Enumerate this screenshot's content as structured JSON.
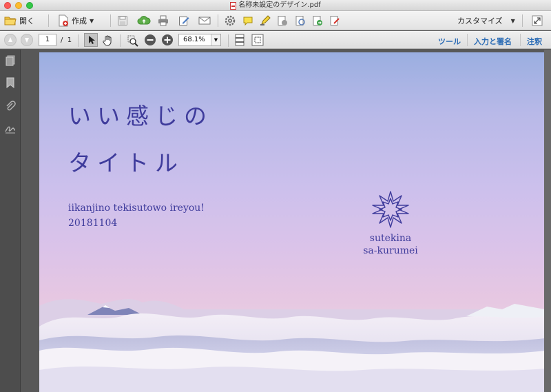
{
  "window": {
    "title": "名称未設定のデザイン.pdf"
  },
  "toolbar": {
    "open_label": "開く",
    "create_label": "作成",
    "customize_label": "カスタマイズ"
  },
  "navigation": {
    "current_page": "1",
    "page_separator": "/",
    "total_pages": "1",
    "zoom": "68.1%"
  },
  "right_tabs": {
    "tools": "ツール",
    "fill_sign": "入力と署名",
    "comment": "注釈"
  },
  "document": {
    "heading_line1": "いい感じの",
    "heading_line2": "タイトル",
    "subtitle": "iikanjino tekisutowo ireyou!",
    "date": "20181104",
    "brand_line1": "sutekina",
    "brand_line2": "sa-kurumei"
  },
  "colors": {
    "accent_blue": "#2a6bb5",
    "text_purple": "#3f3c9c"
  },
  "icons": {
    "open": "folder-icon",
    "create": "create-pdf-icon",
    "save": "save-icon",
    "upload": "cloud-upload-icon",
    "print": "print-icon",
    "edit": "edit-icon",
    "email": "email-icon",
    "settings": "gear-icon",
    "comment": "comment-bubble-icon",
    "highlight": "highlight-icon",
    "stamp": "stamp-icon",
    "attach": "attach-icon",
    "export": "export-icon",
    "sign": "sign-icon",
    "expand": "expand-icon"
  }
}
